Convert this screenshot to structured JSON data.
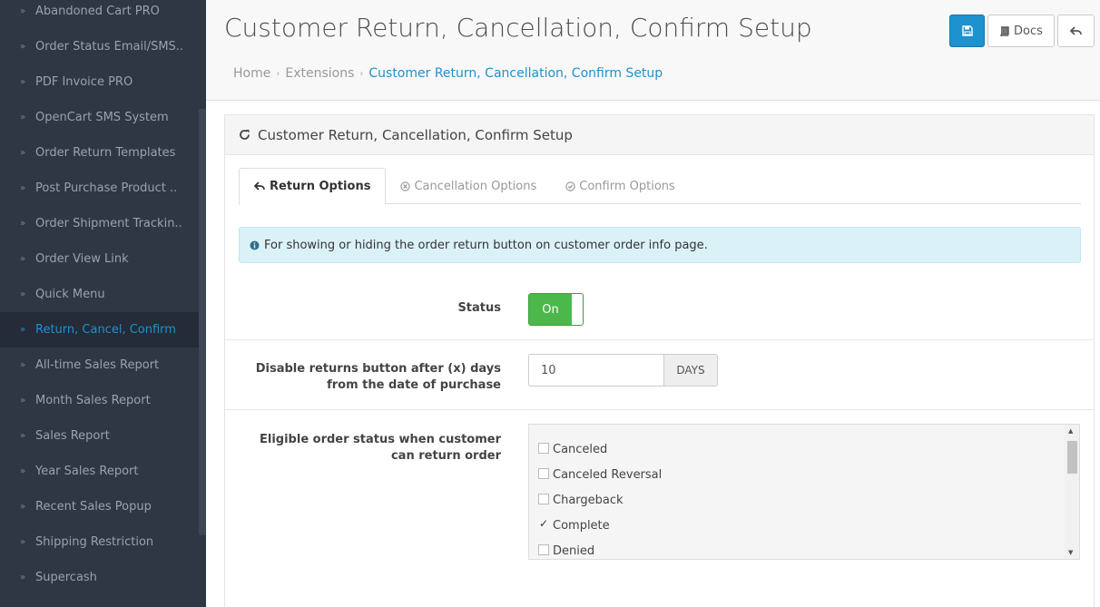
{
  "sidebar": {
    "items": [
      {
        "label": "Abandoned Cart PRO"
      },
      {
        "label": "Order Status Email/SMS.."
      },
      {
        "label": "PDF Invoice PRO"
      },
      {
        "label": "OpenCart SMS System"
      },
      {
        "label": "Order Return Templates"
      },
      {
        "label": "Post Purchase Product .."
      },
      {
        "label": "Order Shipment Trackin.."
      },
      {
        "label": "Order View Link"
      },
      {
        "label": "Quick Menu"
      },
      {
        "label": "Return, Cancel, Confirm"
      },
      {
        "label": "All-time Sales Report"
      },
      {
        "label": "Month Sales Report"
      },
      {
        "label": "Sales Report"
      },
      {
        "label": "Year Sales Report"
      },
      {
        "label": "Recent Sales Popup"
      },
      {
        "label": "Shipping Restriction"
      },
      {
        "label": "Supercash"
      }
    ],
    "active_index": 9
  },
  "header": {
    "title": "Customer Return, Cancellation, Confirm Setup",
    "docs_label": "Docs",
    "breadcrumb": [
      "Home",
      "Extensions",
      "Customer Return, Cancellation, Confirm Setup"
    ]
  },
  "panel": {
    "heading": "Customer Return, Cancellation, Confirm Setup",
    "tabs": [
      {
        "label": "Return Options",
        "icon": "reply-icon",
        "active": true
      },
      {
        "label": "Cancellation Options",
        "icon": "times-circle-icon",
        "active": false
      },
      {
        "label": "Confirm Options",
        "icon": "check-circle-icon",
        "active": false
      }
    ],
    "info_text": "For showing or hiding the order return button on customer order info page."
  },
  "form": {
    "status_label": "Status",
    "status_value": "On",
    "days_label": "Disable returns button after (x) days from the date of purchase",
    "days_value": "10",
    "days_addon": "DAYS",
    "eligible_label": "Eligible order status when customer can return order",
    "order_statuses": [
      {
        "label": "Canceled",
        "checked": false
      },
      {
        "label": "Canceled Reversal",
        "checked": false
      },
      {
        "label": "Chargeback",
        "checked": false
      },
      {
        "label": "Complete",
        "checked": true
      },
      {
        "label": "Denied",
        "checked": false
      }
    ]
  },
  "colors": {
    "sidebar_bg": "#2f3644",
    "accent": "#1e91cf",
    "toggle_on": "#4cb84c",
    "info_bg": "#dbf1f8"
  }
}
